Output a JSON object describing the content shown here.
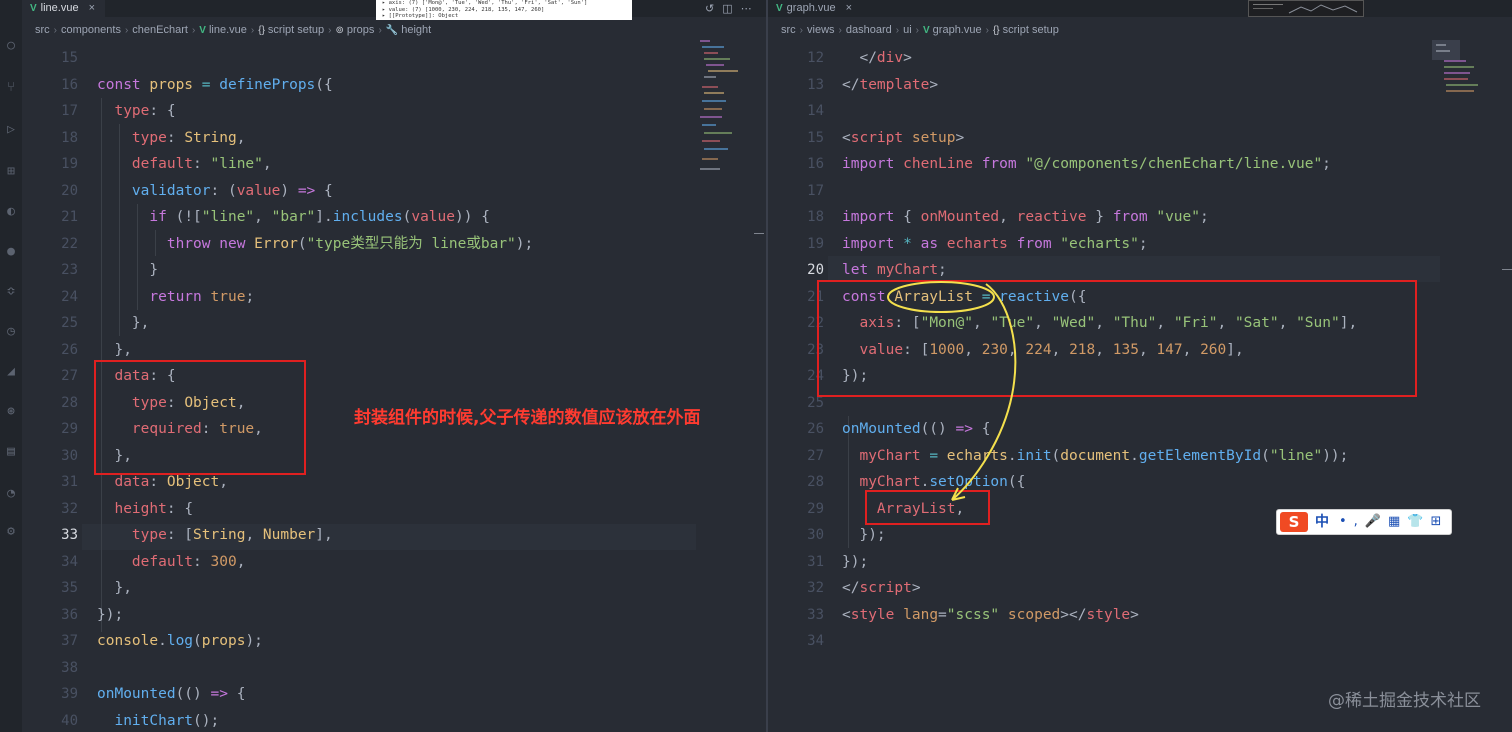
{
  "left_editor": {
    "tab_label": "line.vue",
    "tab_close": "×",
    "breadcrumb": {
      "p1": "src",
      "p2": "components",
      "p3": "chenEchart",
      "p4": "line.vue",
      "p5": "script setup",
      "p6": "props",
      "p7": "height"
    },
    "active_line": 33
  },
  "right_editor": {
    "tab_label": "graph.vue",
    "tab_close": "×",
    "breadcrumb": {
      "p1": "src",
      "p2": "views",
      "p3": "dashoard",
      "p4": "ui",
      "p5": "graph.vue",
      "p6": "script setup"
    },
    "active_line": 20
  },
  "popup_preview": {
    "line1": "▸ axis: (7) ['Mon@', 'Tue', 'Wed', 'Thu', 'Fri', 'Sat', 'Sun']",
    "line2": "▸ value: (7) [1000, 230, 224, 218, 135, 147, 260]",
    "line3": "▸ [[Prototype]]: Object"
  },
  "annotation": "封装组件的时候,父子传递的数值应该放在外面",
  "ime_toolbar": {
    "logo": "S",
    "mode": "中",
    "tools": "•,🎤▦👕⊞"
  },
  "watermark": "@稀土掘金技术社区",
  "colors": {
    "keyword": "#c678dd",
    "variable": "#e5c07b",
    "function": "#61afef",
    "string": "#98c379",
    "number": "#d19a66",
    "property": "#e06c75",
    "operator": "#56b6c2",
    "annotation_red": "#ff3b30"
  },
  "activity_icons": [
    "files-icon",
    "search-icon",
    "source-control-icon",
    "run-debug-icon",
    "extensions-icon",
    "edge-icon",
    "github-icon",
    "remote-icon",
    "timeline-icon",
    "docker-icon",
    "live-share-icon",
    "database-icon",
    "accounts-icon",
    "settings-icon"
  ]
}
